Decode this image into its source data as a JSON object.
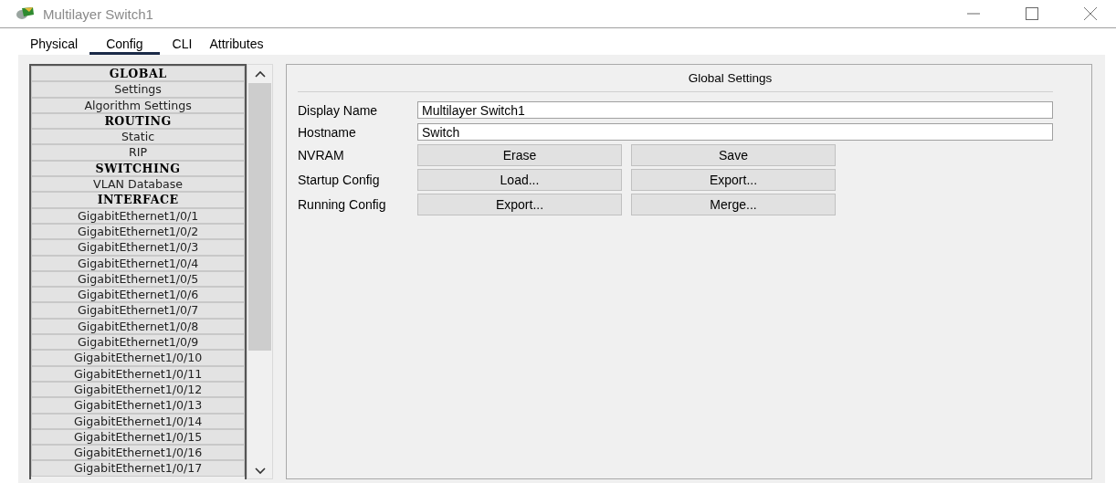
{
  "window": {
    "title": "Multilayer Switch1"
  },
  "tabs": [
    {
      "label": "Physical",
      "selected": false
    },
    {
      "label": "Config",
      "selected": true
    },
    {
      "label": "CLI",
      "selected": false
    },
    {
      "label": "Attributes",
      "selected": false
    }
  ],
  "sidebar": {
    "items": [
      {
        "kind": "header",
        "label": "GLOBAL"
      },
      {
        "kind": "item",
        "label": "Settings"
      },
      {
        "kind": "item",
        "label": "Algorithm Settings"
      },
      {
        "kind": "header",
        "label": "ROUTING"
      },
      {
        "kind": "item",
        "label": "Static"
      },
      {
        "kind": "item",
        "label": "RIP"
      },
      {
        "kind": "header",
        "label": "SWITCHING"
      },
      {
        "kind": "item",
        "label": "VLAN Database"
      },
      {
        "kind": "header",
        "label": "INTERFACE"
      },
      {
        "kind": "item",
        "label": "GigabitEthernet1/0/1"
      },
      {
        "kind": "item",
        "label": "GigabitEthernet1/0/2"
      },
      {
        "kind": "item",
        "label": "GigabitEthernet1/0/3"
      },
      {
        "kind": "item",
        "label": "GigabitEthernet1/0/4"
      },
      {
        "kind": "item",
        "label": "GigabitEthernet1/0/5"
      },
      {
        "kind": "item",
        "label": "GigabitEthernet1/0/6"
      },
      {
        "kind": "item",
        "label": "GigabitEthernet1/0/7"
      },
      {
        "kind": "item",
        "label": "GigabitEthernet1/0/8"
      },
      {
        "kind": "item",
        "label": "GigabitEthernet1/0/9"
      },
      {
        "kind": "item",
        "label": "GigabitEthernet1/0/10"
      },
      {
        "kind": "item",
        "label": "GigabitEthernet1/0/11"
      },
      {
        "kind": "item",
        "label": "GigabitEthernet1/0/12"
      },
      {
        "kind": "item",
        "label": "GigabitEthernet1/0/13"
      },
      {
        "kind": "item",
        "label": "GigabitEthernet1/0/14"
      },
      {
        "kind": "item",
        "label": "GigabitEthernet1/0/15"
      },
      {
        "kind": "item",
        "label": "GigabitEthernet1/0/16"
      },
      {
        "kind": "item",
        "label": "GigabitEthernet1/0/17"
      }
    ]
  },
  "panel": {
    "title": "Global Settings",
    "fields": [
      {
        "label": "Display Name",
        "value": "Multilayer Switch1"
      },
      {
        "label": "Hostname",
        "value": "Switch"
      }
    ],
    "button_rows": [
      {
        "label": "NVRAM",
        "buttons": [
          "Erase",
          "Save"
        ]
      },
      {
        "label": "Startup Config",
        "buttons": [
          "Load...",
          "Export..."
        ]
      },
      {
        "label": "Running Config",
        "buttons": [
          "Export...",
          "Merge..."
        ]
      }
    ]
  }
}
